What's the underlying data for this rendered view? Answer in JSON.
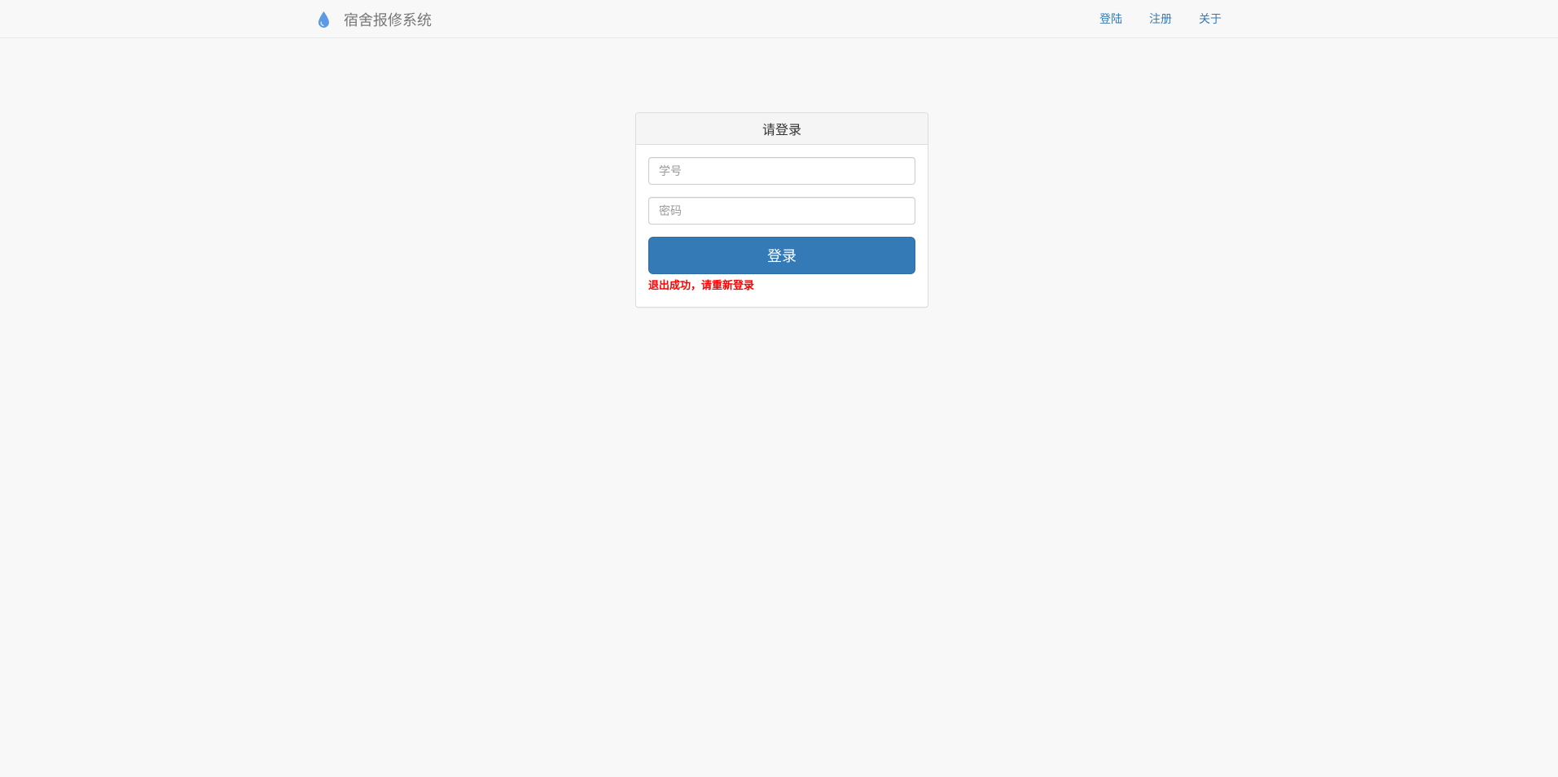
{
  "navbar": {
    "brand_icon": "water-drop-icon",
    "brand_text": "宿舍报修系统",
    "links": [
      {
        "label": "登陆"
      },
      {
        "label": "注册"
      },
      {
        "label": "关于"
      }
    ]
  },
  "login_panel": {
    "title": "请登录",
    "student_id_placeholder": "学号",
    "student_id_value": "",
    "password_placeholder": "密码",
    "password_value": "",
    "submit_label": "登录",
    "message": "退出成功，请重新登录"
  },
  "colors": {
    "primary": "#337ab7",
    "error": "#ff0000",
    "background": "#f8f8f8",
    "brand_icon": "#5b9be6"
  }
}
